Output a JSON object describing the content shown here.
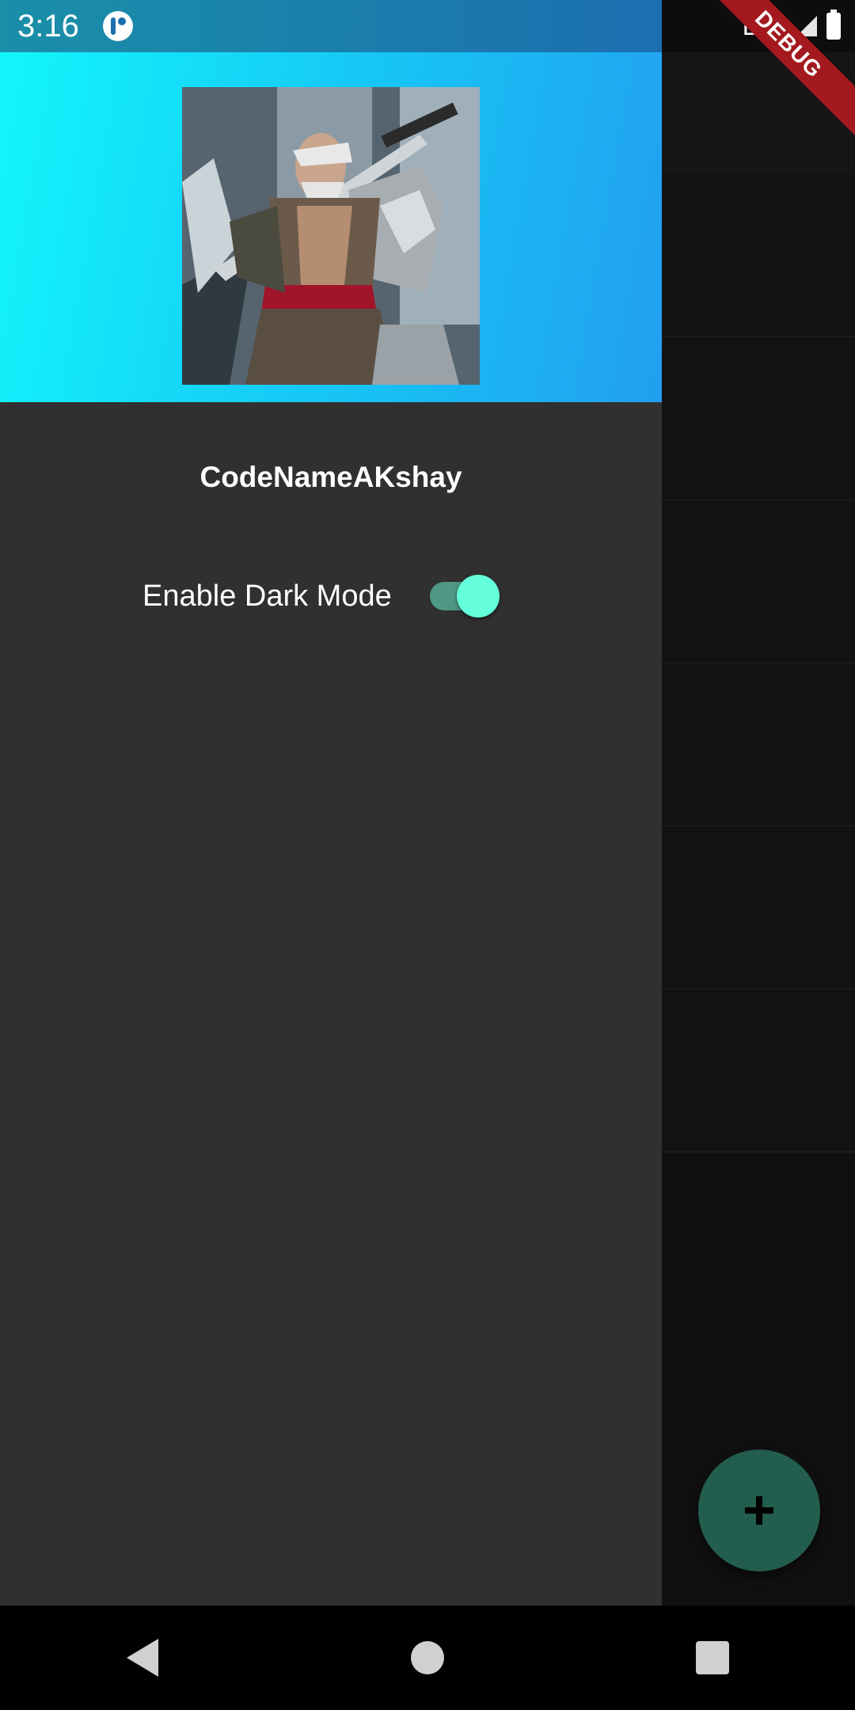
{
  "status_bar": {
    "time": "3:16",
    "network": "LTE",
    "icons": [
      "app-notification-icon",
      "signal-icon",
      "battery-icon"
    ]
  },
  "debug_banner": "DEBUG",
  "drawer": {
    "header": {
      "gradient_colors": [
        "#12f6fb",
        "#229ff0"
      ],
      "avatar": "warrior-portrait-image"
    },
    "user_name": "CodeNameAKshay",
    "dark_mode": {
      "label": "Enable Dark Mode",
      "enabled": true,
      "accent_color": "#64ffda"
    }
  },
  "fab": {
    "icon": "plus-icon",
    "color": "#2e7d68"
  },
  "nav_bar": {
    "buttons": [
      "back-icon",
      "home-icon",
      "recents-icon"
    ]
  }
}
